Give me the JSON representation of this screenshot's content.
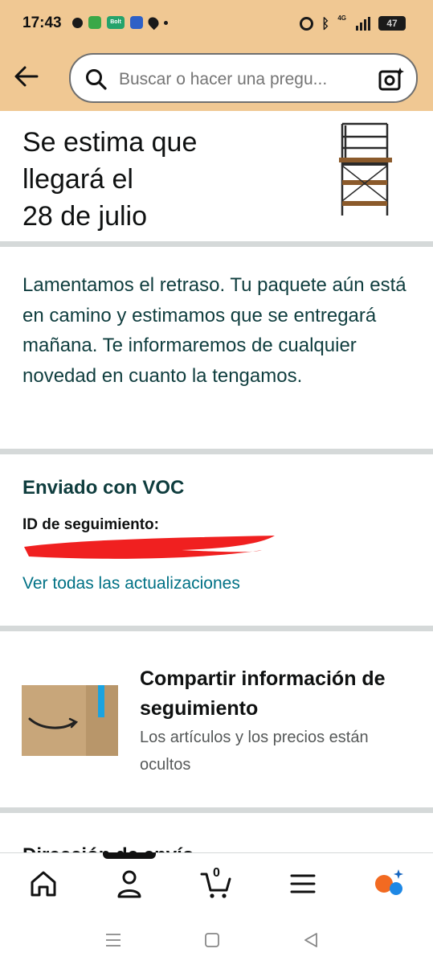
{
  "status_bar": {
    "time": "17:43",
    "network": "4G",
    "battery": "47",
    "app_icons": [
      "chat-icon",
      "shield-app-icon",
      "bolt-app-icon",
      "shazam-app-icon",
      "location-icon",
      "dot-icon"
    ]
  },
  "header": {
    "background_color": "#f0c893",
    "search_placeholder": "Buscar o hacer una pregu..."
  },
  "delivery": {
    "eta_line1": "Se estima que",
    "eta_line2": "llegará el",
    "eta_line3": "28 de julio",
    "delay_message": "Lamentamos el retraso. Tu paquete aún está en camino y estimamos que se entregará mañana. Te informaremos de cualquier novedad en cuanto la tengamos."
  },
  "shipment": {
    "carrier": "Enviado con VOC",
    "tracking_label": "ID de seguimiento:",
    "updates_link": "Ver todas las actualizaciones"
  },
  "share": {
    "title": "Compartir información de seguimiento",
    "subtitle": "Los artículos y los precios están ocultos"
  },
  "next_section": {
    "title": "Dirección de envío"
  },
  "bottom_nav": {
    "items": [
      "home-icon",
      "account-icon",
      "cart-icon",
      "menu-icon",
      "assistant-icon"
    ],
    "cart_count": "0"
  },
  "colors": {
    "link": "#007185",
    "divider": "#d5d9d9",
    "redaction": "#f02020"
  }
}
